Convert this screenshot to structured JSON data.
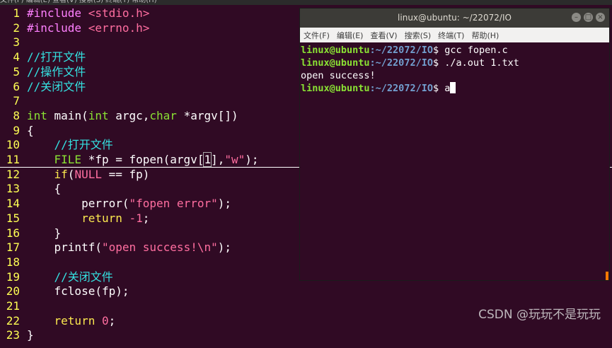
{
  "editor": {
    "menu_strip": "文件(F) 编辑(E) 查看(V) 搜索(S) 终端(T) 帮助(H)",
    "lines": [
      {
        "n": "1",
        "seg": [
          {
            "c": "pre",
            "t": "#include "
          },
          {
            "c": "str",
            "t": "<stdio.h>"
          }
        ]
      },
      {
        "n": "2",
        "seg": [
          {
            "c": "pre",
            "t": "#include "
          },
          {
            "c": "str",
            "t": "<errno.h>"
          }
        ]
      },
      {
        "n": "3",
        "seg": []
      },
      {
        "n": "4",
        "seg": [
          {
            "c": "cm",
            "t": "//打开文件"
          }
        ]
      },
      {
        "n": "5",
        "seg": [
          {
            "c": "cm",
            "t": "//操作文件"
          }
        ]
      },
      {
        "n": "6",
        "seg": [
          {
            "c": "cm",
            "t": "//关闭文件"
          }
        ]
      },
      {
        "n": "7",
        "seg": []
      },
      {
        "n": "8",
        "seg": [
          {
            "c": "ty",
            "t": "int"
          },
          {
            "c": "",
            "t": " main("
          },
          {
            "c": "ty",
            "t": "int"
          },
          {
            "c": "",
            "t": " argc,"
          },
          {
            "c": "ty",
            "t": "char"
          },
          {
            "c": "",
            "t": " *argv[])"
          }
        ]
      },
      {
        "n": "9",
        "seg": [
          {
            "c": "",
            "t": "{"
          }
        ]
      },
      {
        "n": "10",
        "seg": [
          {
            "c": "",
            "t": "    "
          },
          {
            "c": "cm",
            "t": "//打开文件"
          }
        ]
      },
      {
        "n": "11",
        "cursorline": true,
        "seg": [
          {
            "c": "",
            "t": "    "
          },
          {
            "c": "ty",
            "t": "FILE"
          },
          {
            "c": "",
            "t": " *fp = fopen(argv["
          },
          {
            "c": "hl",
            "t": "1"
          },
          {
            "c": "",
            "t": "],"
          },
          {
            "c": "str",
            "t": "\"w\""
          },
          {
            "c": "",
            "t": ");"
          }
        ]
      },
      {
        "n": "12",
        "seg": [
          {
            "c": "",
            "t": "    "
          },
          {
            "c": "kw",
            "t": "if"
          },
          {
            "c": "",
            "t": "("
          },
          {
            "c": "str",
            "t": "NULL"
          },
          {
            "c": "",
            "t": " == fp)"
          }
        ]
      },
      {
        "n": "13",
        "seg": [
          {
            "c": "",
            "t": "    {"
          }
        ]
      },
      {
        "n": "14",
        "seg": [
          {
            "c": "",
            "t": "        perror("
          },
          {
            "c": "str",
            "t": "\"fopen error\""
          },
          {
            "c": "",
            "t": ");"
          }
        ]
      },
      {
        "n": "15",
        "seg": [
          {
            "c": "",
            "t": "        "
          },
          {
            "c": "kw",
            "t": "return"
          },
          {
            "c": "",
            "t": " "
          },
          {
            "c": "str",
            "t": "-1"
          },
          {
            "c": "",
            "t": ";"
          }
        ]
      },
      {
        "n": "16",
        "seg": [
          {
            "c": "",
            "t": "    }"
          }
        ]
      },
      {
        "n": "17",
        "seg": [
          {
            "c": "",
            "t": "    printf("
          },
          {
            "c": "str",
            "t": "\"open success!\\n\""
          },
          {
            "c": "",
            "t": ");"
          }
        ]
      },
      {
        "n": "18",
        "seg": []
      },
      {
        "n": "19",
        "seg": [
          {
            "c": "",
            "t": "    "
          },
          {
            "c": "cm",
            "t": "//关闭文件"
          }
        ]
      },
      {
        "n": "20",
        "seg": [
          {
            "c": "",
            "t": "    fclose(fp);"
          }
        ]
      },
      {
        "n": "21",
        "seg": []
      },
      {
        "n": "22",
        "seg": [
          {
            "c": "",
            "t": "    "
          },
          {
            "c": "kw",
            "t": "return"
          },
          {
            "c": "",
            "t": " "
          },
          {
            "c": "str",
            "t": "0"
          },
          {
            "c": "",
            "t": ";"
          }
        ]
      },
      {
        "n": "23",
        "seg": [
          {
            "c": "",
            "t": "}"
          }
        ]
      }
    ]
  },
  "terminal": {
    "title": "linux@ubuntu: ~/22072/IO",
    "window_buttons": [
      "–",
      "□",
      "×"
    ],
    "menu": [
      "文件(F)",
      "编辑(E)",
      "查看(V)",
      "搜索(S)",
      "终端(T)",
      "帮助(H)"
    ],
    "lines": [
      {
        "user": "linux@ubuntu",
        "path": ":~/22072/IO",
        "sym": "$ ",
        "cmd": "gcc fopen.c"
      },
      {
        "user": "linux@ubuntu",
        "path": ":~/22072/IO",
        "sym": "$ ",
        "cmd": "./a.out 1.txt"
      },
      {
        "output": "open success!"
      },
      {
        "user": "linux@ubuntu",
        "path": ":~/22072/IO",
        "sym": "$ ",
        "cmd": "a",
        "cursor": true
      }
    ]
  },
  "watermark": "CSDN @玩玩不是玩玩",
  "colors": {
    "background": "#300a24",
    "line_number": "#ffff54",
    "comment": "#34e2e2",
    "string": "#ff6ea0",
    "type": "#8ae234",
    "keyword": "#fce94f",
    "preproc": "#ff80ff",
    "prompt_user": "#8ae234",
    "prompt_path": "#729fcf"
  }
}
